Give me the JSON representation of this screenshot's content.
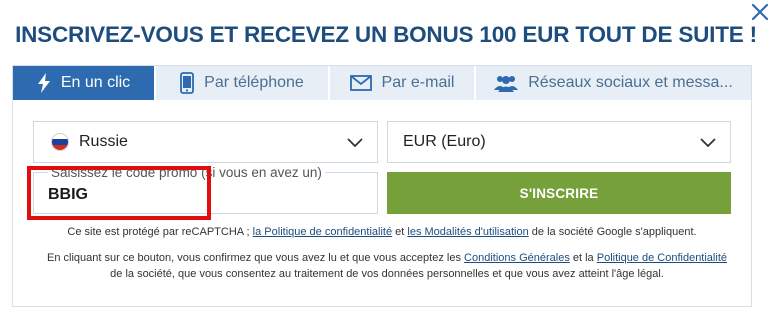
{
  "modal": {
    "headline": "INSCRIVEZ-VOUS ET RECEVEZ UN BONUS 100 EUR TOUT DE SUITE !",
    "close_icon": "close-icon"
  },
  "tabs": [
    {
      "label": "En un clic",
      "icon": "lightning-icon",
      "active": true
    },
    {
      "label": "Par téléphone",
      "icon": "smartphone-icon",
      "active": false
    },
    {
      "label": "Par e-mail",
      "icon": "envelope-icon",
      "active": false
    },
    {
      "label": "Réseaux sociaux et messa...",
      "icon": "users-icon",
      "active": false
    }
  ],
  "form": {
    "country": {
      "value": "Russie",
      "flag_icon": "russia-flag-icon"
    },
    "currency": {
      "value": "EUR (Euro)"
    },
    "promo": {
      "label": "Saisissez le code promo (si vous en avez un)",
      "value": "BBIG"
    },
    "signup_label": "S'INSCRIRE"
  },
  "legal": {
    "recaptcha": {
      "p1": "Ce site est protégé par reCAPTCHA ; ",
      "privacy_link": "la Politique de confidentialité",
      "p2": " et ",
      "terms_link": "les Modalités d'utilisation",
      "p3": " de la société Google s'appliquent."
    },
    "consent": {
      "p1": "En cliquant sur ce bouton, vous confirmez que vous avez lu et que vous acceptez les ",
      "terms_link": "Conditions Générales",
      "p2": " et la ",
      "privacy_link": "Politique de Confidentialité",
      "p3": " de la société, que vous consentez au traitement de vos données personnelles et que vous avez atteint l'âge légal."
    }
  },
  "colors": {
    "headline": "#1d4d7e",
    "tab_active": "#2d6ab0",
    "tab_inactive_bg": "#e7eef6",
    "tab_inactive_text": "#4a6f94",
    "signup_button": "#76a03a",
    "highlight_border": "#e20e0e",
    "flag": [
      "#ffffff",
      "#1c3fa0",
      "#d52b1e"
    ]
  }
}
